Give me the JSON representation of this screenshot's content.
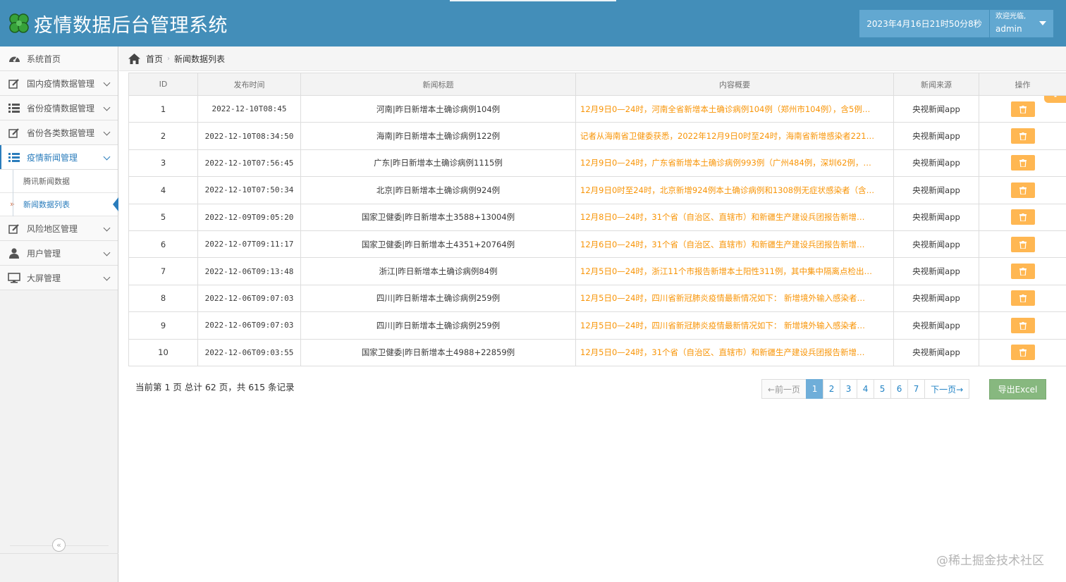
{
  "header": {
    "title": "疫情数据后台管理系统",
    "clock": "2023年4月16日21时50分8秒",
    "welcome": "欢迎光临,",
    "username": "admin"
  },
  "sidebar": {
    "items": [
      {
        "label": "系统首页",
        "icon": "dashboard-icon"
      },
      {
        "label": "国内疫情数据管理",
        "icon": "pencil-square-icon"
      },
      {
        "label": "省份疫情数据管理",
        "icon": "list-icon"
      },
      {
        "label": "省份各类数据管理",
        "icon": "pencil-square-icon"
      },
      {
        "label": "疫情新闻管理",
        "icon": "list-icon"
      },
      {
        "label": "风险地区管理",
        "icon": "pencil-square-icon"
      },
      {
        "label": "用户管理",
        "icon": "user-icon"
      },
      {
        "label": "大屏管理",
        "icon": "desktop-icon"
      }
    ],
    "sub_items": [
      {
        "label": "腾讯新闻数据"
      },
      {
        "label": "新闻数据列表"
      }
    ]
  },
  "breadcrumb": {
    "home": "首页",
    "current": "新闻数据列表"
  },
  "table": {
    "headers": [
      "ID",
      "发布时间",
      "新闻标题",
      "内容概要",
      "新闻来源",
      "操作"
    ],
    "rows": [
      {
        "id": "1",
        "time": "2022-12-10T08:45",
        "title": "河南|昨日新增本土确诊病例104例",
        "summary": "12月9日0—24时，河南全省新增本土确诊病例104例（郑州市104例），含5例…",
        "source": "央视新闻app"
      },
      {
        "id": "2",
        "time": "2022-12-10T08:34:50",
        "title": "海南|昨日新增本土确诊病例122例",
        "summary": "记者从海南省卫健委获悉，2022年12月9日0时至24时，海南省新增感染者221…",
        "source": "央视新闻app"
      },
      {
        "id": "3",
        "time": "2022-12-10T07:56:45",
        "title": "广东|昨日新增本土确诊病例1115例",
        "summary": "12月9日0—24时，广东省新增本土确诊病例993例（广州484例，深圳62例，…",
        "source": "央视新闻app"
      },
      {
        "id": "4",
        "time": "2022-12-10T07:50:34",
        "title": "北京|昨日新增本土确诊病例924例",
        "summary": "12月9日0时至24时，北京新增924例本土确诊病例和1308例无症状感染者（含…",
        "source": "央视新闻app"
      },
      {
        "id": "5",
        "time": "2022-12-09T09:05:20",
        "title": "国家卫健委|昨日新增本土3588+13004例",
        "summary": "12月8日0—24时，31个省（自治区、直辖市）和新疆生产建设兵团报告新增…",
        "source": "央视新闻app"
      },
      {
        "id": "6",
        "time": "2022-12-07T09:11:17",
        "title": "国家卫健委|昨日新增本土4351+20764例",
        "summary": "12月6日0—24时，31个省（自治区、直辖市）和新疆生产建设兵团报告新增…",
        "source": "央视新闻app"
      },
      {
        "id": "7",
        "time": "2022-12-06T09:13:48",
        "title": "浙江|昨日新增本土确诊病例84例",
        "summary": "12月5日0—24时，浙江11个市报告新增本土阳性311例，其中集中隔离点检出…",
        "source": "央视新闻app"
      },
      {
        "id": "8",
        "time": "2022-12-06T09:07:03",
        "title": "四川|昨日新增本土确诊病例259例",
        "summary": "12月5日0—24时，四川省新冠肺炎疫情最新情况如下： 新增境外输入感染者…",
        "source": "央视新闻app"
      },
      {
        "id": "9",
        "time": "2022-12-06T09:07:03",
        "title": "四川|昨日新增本土确诊病例259例",
        "summary": "12月5日0—24时，四川省新冠肺炎疫情最新情况如下： 新增境外输入感染者…",
        "source": "央视新闻app"
      },
      {
        "id": "10",
        "time": "2022-12-06T09:03:55",
        "title": "国家卫健委|昨日新增本土4988+22859例",
        "summary": "12月5日0—24时，31个省（自治区、直辖市）和新疆生产建设兵团报告新增…",
        "source": "央视新闻app"
      }
    ]
  },
  "pager": {
    "info": "当前第 1 页 总计 62 页，共 615 条记录",
    "prev": "←前一页",
    "pages": [
      "1",
      "2",
      "3",
      "4",
      "5",
      "6",
      "7"
    ],
    "current_page": "1",
    "next": "下一页→",
    "export": "导出Excel"
  },
  "watermark": "@稀土掘金技术社区",
  "colors": {
    "header": "#438eb9",
    "accent": "#2b7dbc",
    "warning": "#ffb752",
    "summary_text": "#f89406",
    "success": "#87b87f"
  }
}
